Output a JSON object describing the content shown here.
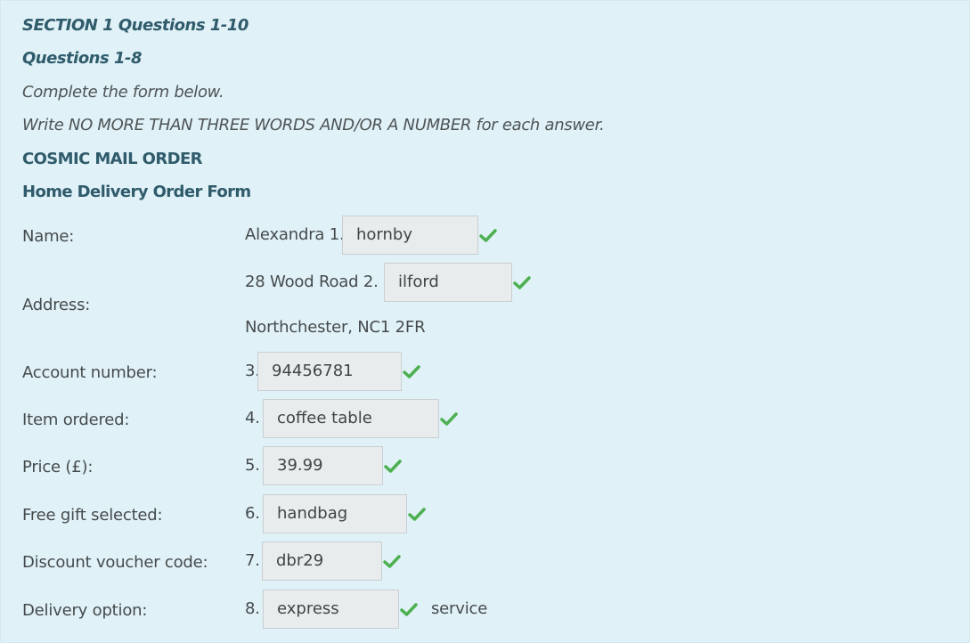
{
  "section_title": "SECTION 1  Questions 1-10",
  "questions_range": "Questions 1-8",
  "instruction_1": "Complete the form below.",
  "instruction_2": "Write NO MORE THAN THREE WORDS AND/OR A NUMBER for each answer.",
  "form_company": "COSMIC MAIL ORDER",
  "form_title": "Home Delivery Order Form",
  "fields": {
    "name": {
      "label": "Name:",
      "prefix": "Alexandra 1.",
      "answer": "hornby"
    },
    "address": {
      "label": "Address:",
      "prefix": "28 Wood Road 2.",
      "answer": "ilford",
      "line2": "Northchester, NC1 2FR"
    },
    "account": {
      "label": "Account number:",
      "prefix": "3.",
      "answer": "94456781"
    },
    "item": {
      "label": "Item ordered:",
      "prefix": "4.",
      "answer": "coffee table"
    },
    "price": {
      "label": "Price (£):",
      "prefix": "5.",
      "answer": "39.99"
    },
    "gift": {
      "label": "Free gift selected:",
      "prefix": "6.",
      "answer": "handbag"
    },
    "voucher": {
      "label": "Discount voucher code:",
      "prefix": "7.",
      "answer": "dbr29"
    },
    "delivery": {
      "label": "Delivery option:",
      "prefix": "8.",
      "answer": "express",
      "suffix": "service"
    }
  },
  "check_icon": "check-icon",
  "colors": {
    "background": "#e0f1f7",
    "heading": "#2f5b6b",
    "check": "#4cb050",
    "answer_bg": "#e8eced"
  }
}
